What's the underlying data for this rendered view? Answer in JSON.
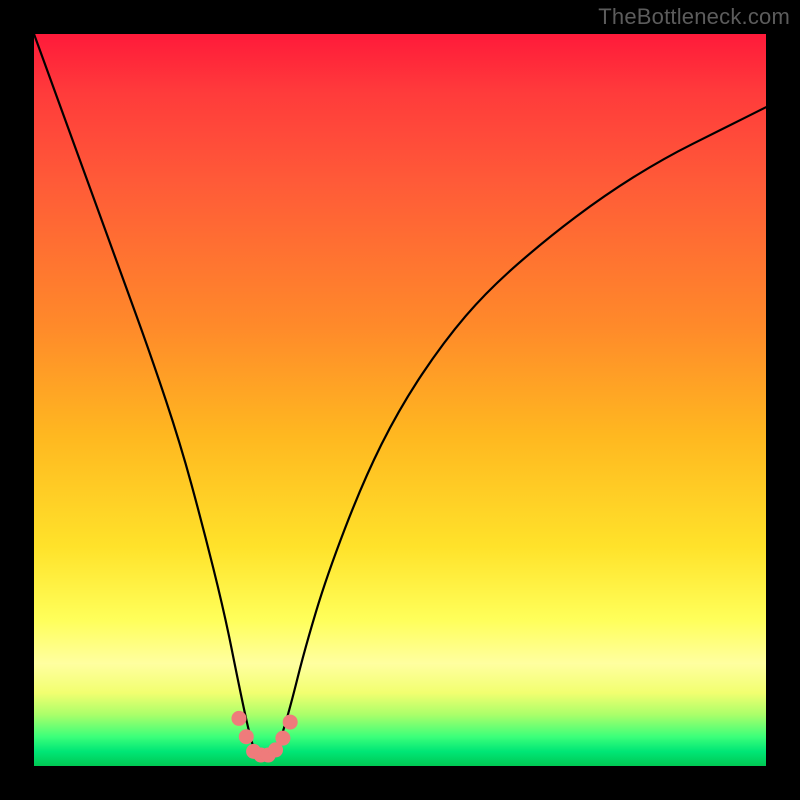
{
  "watermark": "TheBottleneck.com",
  "chart_data": {
    "type": "line",
    "title": "",
    "xlabel": "",
    "ylabel": "",
    "xlim": [
      0,
      100
    ],
    "ylim": [
      0,
      100
    ],
    "series": [
      {
        "name": "bottleneck-curve",
        "x": [
          0,
          4,
          8,
          12,
          16,
          20,
          23,
          26,
          28,
          29.5,
          30.5,
          32,
          33.5,
          35,
          37,
          40,
          45,
          50,
          56,
          62,
          70,
          78,
          86,
          94,
          100
        ],
        "values": [
          100,
          89,
          78,
          67,
          56,
          44,
          33,
          21,
          11,
          4,
          1,
          1,
          3,
          8,
          16,
          26,
          39,
          49,
          58,
          65,
          72,
          78,
          83,
          87,
          90
        ]
      },
      {
        "name": "highlight-dots",
        "x": [
          28,
          29,
          30,
          31,
          32,
          33,
          34,
          35
        ],
        "values": [
          6.5,
          4,
          2,
          1.5,
          1.5,
          2.2,
          3.8,
          6
        ]
      }
    ],
    "colors": {
      "curve": "#000000",
      "dots": "#ef7b7b"
    }
  }
}
